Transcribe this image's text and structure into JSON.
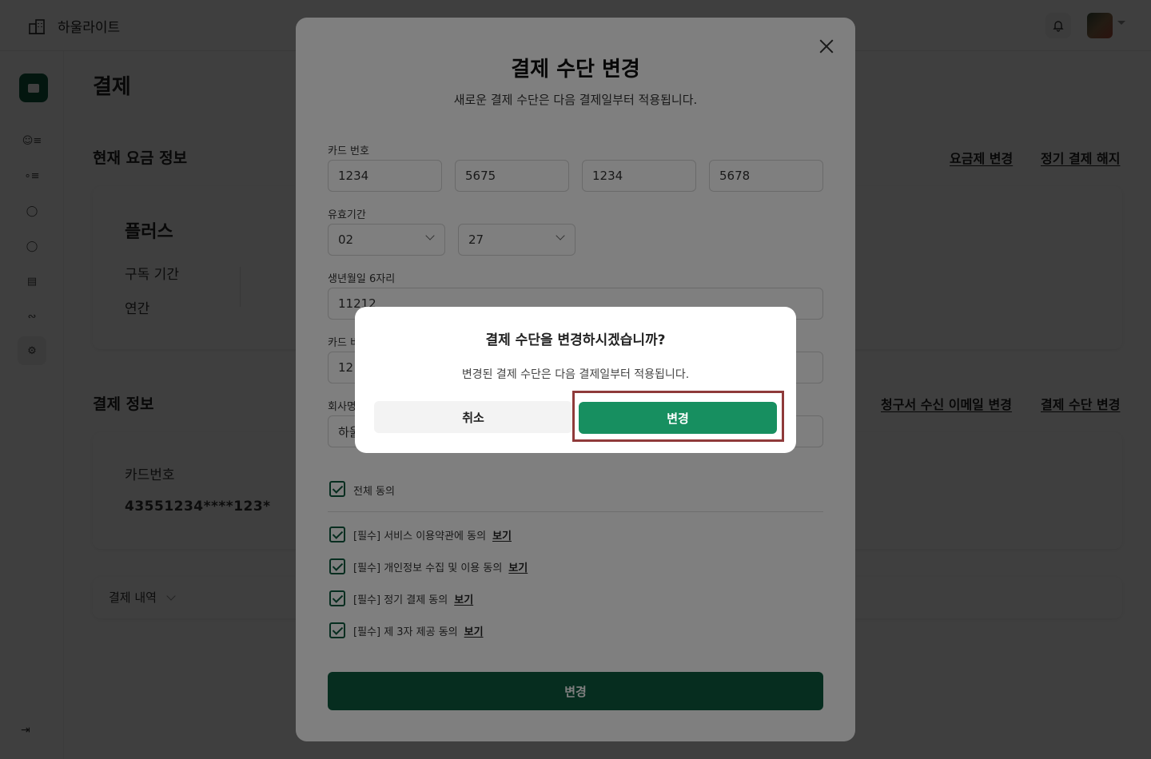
{
  "app": {
    "name": "하울라이트"
  },
  "page": {
    "title": "결제",
    "current_plan": {
      "section_title": "현재 요금 정보",
      "change_plan_link": "요금제 변경",
      "cancel_subscription_link": "정기 결제 해지",
      "plan_name": "플러스",
      "rows": [
        {
          "label": "구독 기간"
        },
        {
          "label": "연간"
        }
      ]
    },
    "payment_info": {
      "section_title": "결제 정보",
      "invoice_email_link": "청구서 수신 이메일 변경",
      "change_method_link": "결제 수단 변경",
      "card_label": "카드번호",
      "card_number": "43551234****123*"
    },
    "history": {
      "label": "결제 내역"
    }
  },
  "modal": {
    "title": "결제 수단 변경",
    "subtitle": "새로운 결제 수단은 다음 결제일부터 적용됩니다.",
    "card_number_label": "카드 번호",
    "card_number_parts": [
      "1234",
      "5675",
      "1234",
      "5678"
    ],
    "expiry_label": "유효기간",
    "expiry_month": "02",
    "expiry_year": "27",
    "birth_label": "생년월일 6자리",
    "birth_value": "11212",
    "card_pw_label_partial": "카드 비",
    "card_pw_value_partial": "12",
    "company_label_partial": "회사명",
    "company_value_partial": "하울",
    "agree_all": "전체 동의",
    "agreements": [
      {
        "text": "[필수] 서비스 이용약관에 동의",
        "link": "보기"
      },
      {
        "text": "[필수] 개인정보 수집 및 이용 동의",
        "link": "보기"
      },
      {
        "text": "[필수] 정기 결제 동의",
        "link": "보기"
      },
      {
        "text": "[필수] 제 3자 제공 동의",
        "link": "보기"
      }
    ],
    "submit_label": "변경"
  },
  "confirm": {
    "title": "결제 수단을 변경하시겠습니까?",
    "message": "변경된 결제 수단은 다음 결제일부터 적용됩니다.",
    "cancel_label": "취소",
    "confirm_label": "변경"
  },
  "colors": {
    "brand_dark_green": "#0d5a3e",
    "confirm_green": "#178f60",
    "highlight_border": "#8f3a3a"
  },
  "icons": {
    "brand": "building-icon",
    "notifications": "bell-icon",
    "sidebar": [
      "briefcase-icon",
      "user-list-icon",
      "share-icon",
      "chat-icon",
      "chat-icon",
      "document-icon",
      "wrench-icon",
      "gear-icon",
      "collapse-icon"
    ]
  }
}
